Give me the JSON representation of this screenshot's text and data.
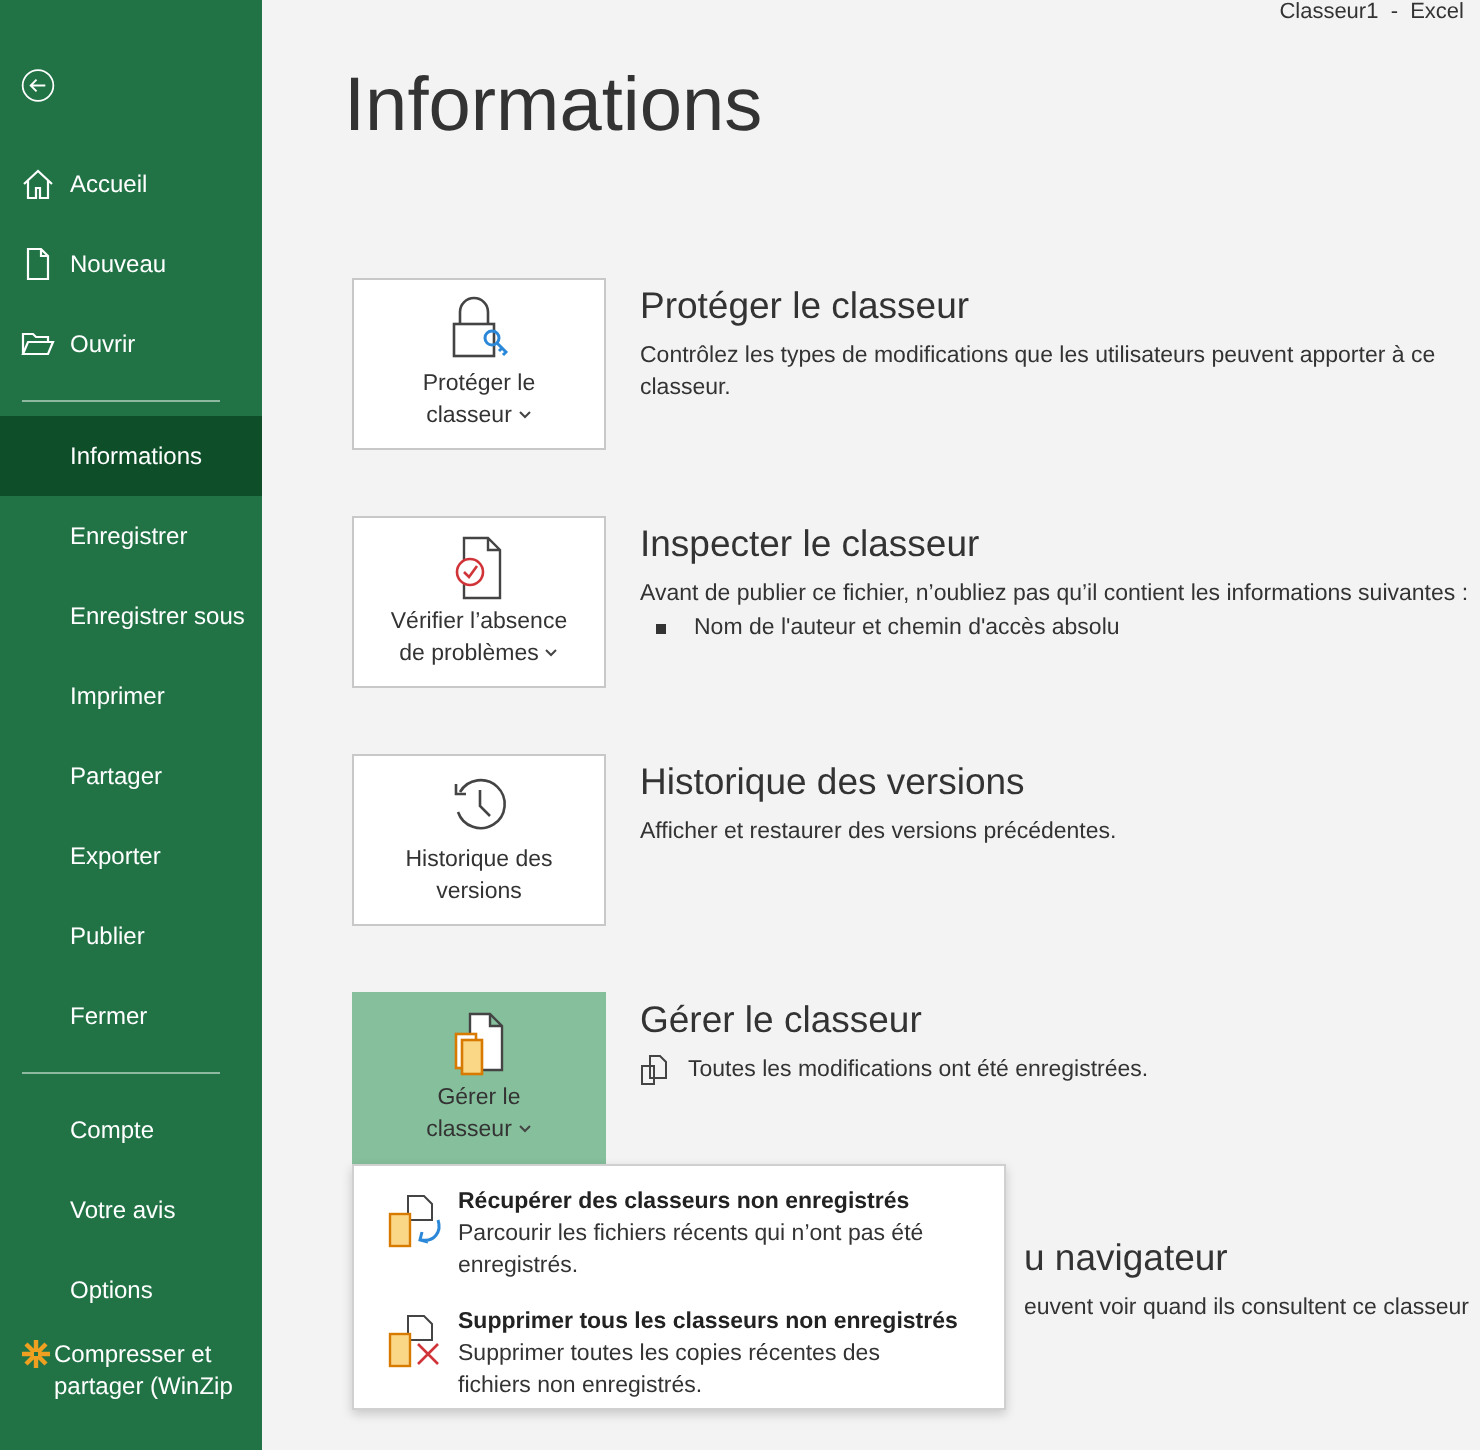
{
  "window": {
    "title": "Classeur1  -  Excel"
  },
  "sidebar": {
    "primary": [
      {
        "label": "Accueil",
        "selected": false
      },
      {
        "label": "Nouveau",
        "selected": false
      },
      {
        "label": "Ouvrir",
        "selected": false
      }
    ],
    "main": [
      {
        "label": "Informations",
        "selected": true
      },
      {
        "label": "Enregistrer",
        "selected": false
      },
      {
        "label": "Enregistrer sous",
        "selected": false
      },
      {
        "label": "Imprimer",
        "selected": false
      },
      {
        "label": "Partager",
        "selected": false
      },
      {
        "label": "Exporter",
        "selected": false
      },
      {
        "label": "Publier",
        "selected": false
      },
      {
        "label": "Fermer",
        "selected": false
      }
    ],
    "bottom": [
      {
        "label": "Compte",
        "selected": false
      },
      {
        "label": "Votre avis",
        "selected": false
      },
      {
        "label": "Options",
        "selected": false
      },
      {
        "label": "Compresser et partager (WinZip",
        "selected": false
      }
    ]
  },
  "page_title": "Informations",
  "sections": [
    {
      "button_lines": [
        "Protéger le",
        "classeur"
      ],
      "has_menu": true,
      "selected": false,
      "title": "Protéger le classeur",
      "description": "Contrôlez les types de modifications que les utilisateurs peuvent apporter à ce classeur."
    },
    {
      "button_lines": [
        "Vérifier l’absence",
        "de problèmes"
      ],
      "has_menu": true,
      "selected": false,
      "title": "Inspecter le classeur",
      "description": "Avant de publier ce fichier, n’oubliez pas qu’il contient les informations suivantes :",
      "bullets": [
        "Nom de l'auteur et chemin d'accès absolu"
      ]
    },
    {
      "button_lines": [
        "Historique des",
        "versions"
      ],
      "has_menu": false,
      "selected": false,
      "title": "Historique des versions",
      "description": "Afficher et restaurer des versions précédentes."
    },
    {
      "button_lines": [
        "Gérer le",
        "classeur"
      ],
      "has_menu": true,
      "selected": true,
      "title": "Gérer le classeur",
      "status": "Toutes les modifications ont été enregistrées."
    }
  ],
  "covered_section": {
    "title": "u navigateur",
    "description": "euvent voir quand ils consultent ce classeur"
  },
  "dropdown": [
    {
      "title": "Récupérer des classeurs non enregistrés",
      "description": "Parcourir les fichiers récents qui n’ont pas été enregistrés."
    },
    {
      "title": "Supprimer tous les classeurs non enregistrés",
      "description": "Supprimer toutes les copies récentes des fichiers non enregistrés."
    }
  ]
}
